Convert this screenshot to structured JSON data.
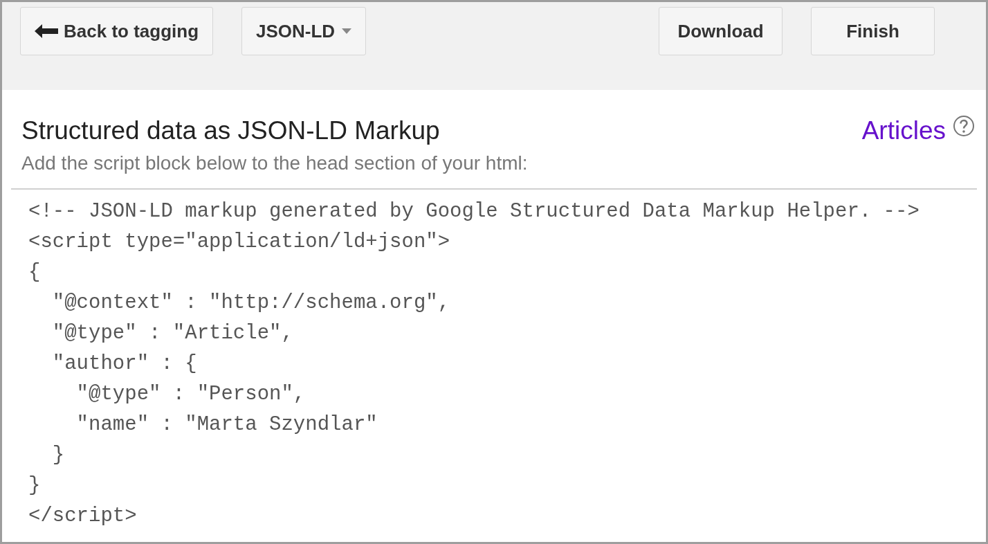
{
  "toolbar": {
    "left_buttons": [
      {
        "label": "Back to tagging",
        "kind": "back"
      },
      {
        "label": "JSON-LD",
        "kind": "dropdown"
      }
    ],
    "right_buttons": [
      {
        "label": "Download"
      },
      {
        "label": "Finish"
      }
    ]
  },
  "header": {
    "title": "Structured data as JSON-LD Markup",
    "subtitle": "Add the script block below to the head section of your html:",
    "link": "Articles"
  },
  "code_lines": [
    "<!-- JSON-LD markup generated by Google Structured Data Markup Helper. -->",
    "<script type=\"application/ld+json\">",
    "{",
    "  \"@context\" : \"http://schema.org\",",
    "  \"@type\" : \"Article\",",
    "  \"author\" : {",
    "    \"@type\" : \"Person\",",
    "    \"name\" : \"Marta Szyndlar\"",
    "  }",
    "}",
    "</script>"
  ]
}
